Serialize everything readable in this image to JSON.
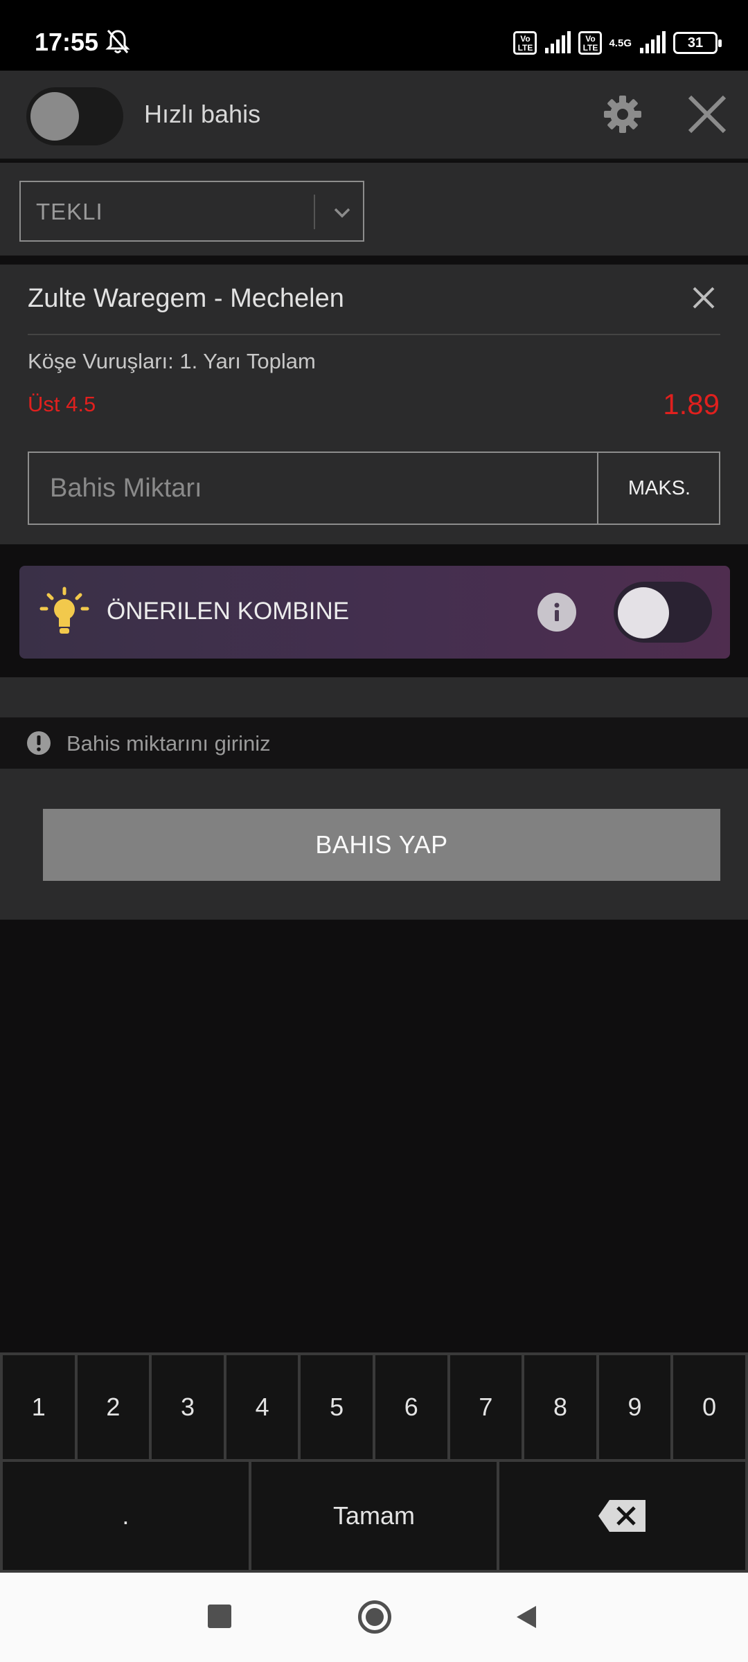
{
  "status_bar": {
    "time": "17:55",
    "volte1": "Vo LTE",
    "volte2": "Vo LTE",
    "network": "4.5G",
    "battery": "31"
  },
  "header": {
    "quick_bet_label": "Hızlı bahis",
    "quick_bet_enabled": false
  },
  "bet_type": {
    "selected": "TEKLI"
  },
  "bet_item": {
    "match": "Zulte Waregem - Mechelen",
    "market": "Köşe Vuruşları: 1. Yarı Toplam",
    "selection": "Üst 4.5",
    "odds": "1.89",
    "stake_placeholder": "Bahis Miktarı",
    "max_label": "MAKS."
  },
  "combo": {
    "label": "ÖNERILEN KOMBINE",
    "enabled": false
  },
  "warning": {
    "text": "Bahis miktarını giriniz"
  },
  "place_bet": {
    "label": "BAHIS YAP"
  },
  "keypad": {
    "digits": [
      "1",
      "2",
      "3",
      "4",
      "5",
      "6",
      "7",
      "8",
      "9",
      "0"
    ],
    "dot": ".",
    "done": "Tamam"
  },
  "colors": {
    "accent_red": "#e0201e",
    "panel": "#2b2b2c",
    "combo_gradient_start": "#3a3047",
    "combo_gradient_end": "#4f2d4f",
    "bulb": "#f2c94c"
  }
}
